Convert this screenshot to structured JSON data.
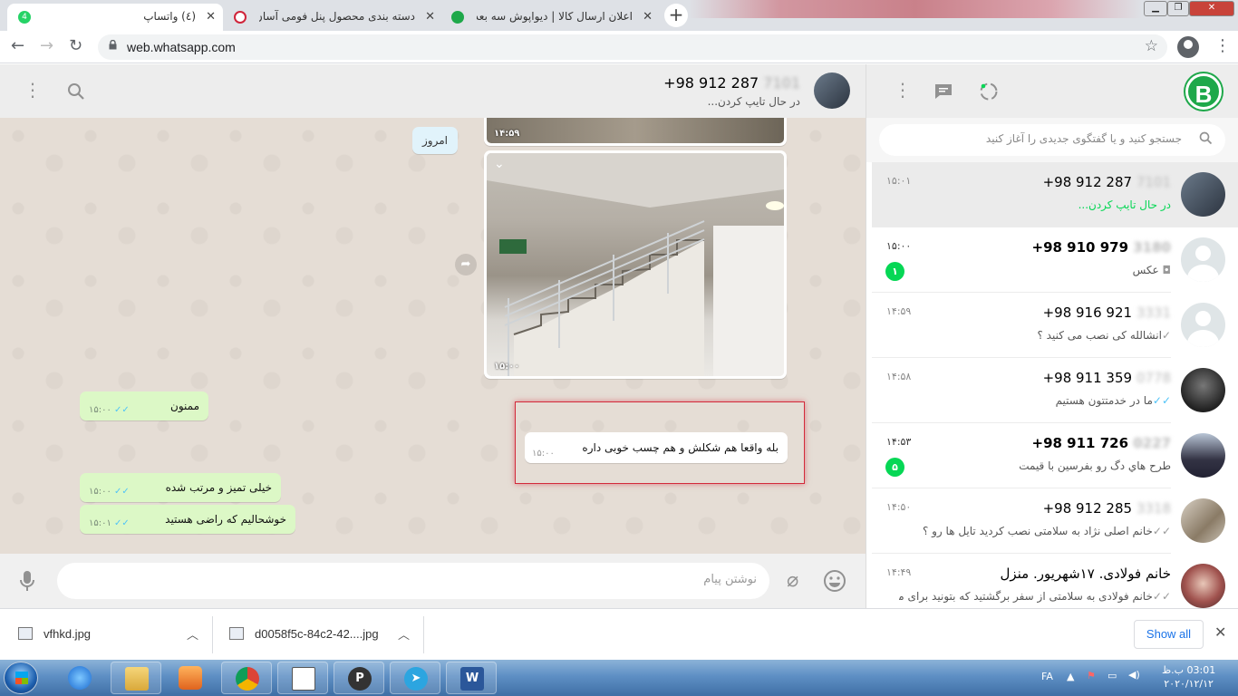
{
  "browser": {
    "tabs": [
      {
        "title": "(٤) واتساپ",
        "badge": "4",
        "active": true
      },
      {
        "title": "دسته بندی محصول پنل فومی آسان نصب -"
      },
      {
        "title": "اعلان ارسال کالا | دیواپوش سه بعدی"
      }
    ],
    "new_tab": "+",
    "url": "web.whatsapp.com"
  },
  "chat": {
    "contact_name": "+98 912 287",
    "contact_name_blurred": "7101",
    "contact_status": "در حال تایپ کردن...",
    "date_chip": "امروز",
    "messages": [
      {
        "type": "image",
        "time": "۱۴:۵۹"
      },
      {
        "type": "image",
        "time": "۱۵:۰۰"
      },
      {
        "type": "in",
        "text": "ممنون",
        "time": "۱۵:۰۰"
      },
      {
        "type": "out",
        "text": "بله واقعا هم شکلش و هم چسب خوبی داره",
        "time": "۱۵:۰۰"
      },
      {
        "type": "in",
        "text": "خیلی تمیز و مرتب شده",
        "time": "۱۵:۰۰"
      },
      {
        "type": "in",
        "text": "خوشحالیم که راضی هستید",
        "time": "۱۵:۰۱"
      }
    ],
    "composer_placeholder": "نوشتن پیام"
  },
  "sidebar": {
    "search_placeholder": "جستجو کنید و یا گفتگوی جدیدی را آغاز کنید",
    "logo_letter": "B",
    "chats": [
      {
        "name": "+98 912 287",
        "blurred": "7101",
        "preview": "در حال تایپ کردن...",
        "time": "۱۵:۰۱",
        "active": true
      },
      {
        "name": "+98 910 979",
        "blurred": "3180",
        "preview": "عکس",
        "time": "۱۵:۰۰",
        "badge": "۱"
      },
      {
        "name": "+98 916 921",
        "blurred": "3331",
        "preview": "انشالله کی نصب می کنید ؟",
        "time": "۱۴:۵۹"
      },
      {
        "name": "+98 911 359",
        "blurred": "0778",
        "preview": "ما در خدمتتون هستیم",
        "time": "۱۴:۵۸"
      },
      {
        "name": "+98 911 726",
        "blurred": "0227",
        "preview": "طرح هاي دگ رو بفرسين با قيمت",
        "time": "۱۴:۵۳",
        "badge": "۵"
      },
      {
        "name": "+98 912 285",
        "blurred": "3318",
        "preview": "خانم اصلی نژاد به سلامتی نصب کردید تایل ها رو ؟",
        "time": "۱۴:۵۰"
      },
      {
        "name": "خانم فولادی. ۱۷شهریور. منزل",
        "preview": "خانم فولادی به سلامتی از سفر برگشتید که بتونید برای ما ع...",
        "time": "۱۴:۴۹"
      }
    ]
  },
  "downloads": {
    "items": [
      "vfhkd.jpg",
      "d0058f5c-84c2-42....jpg"
    ],
    "show_all": "Show all"
  },
  "taskbar": {
    "lang": "FA",
    "time": "03:01 ب.ظ",
    "date": "۲۰۲۰/۱۲/۱۲"
  }
}
